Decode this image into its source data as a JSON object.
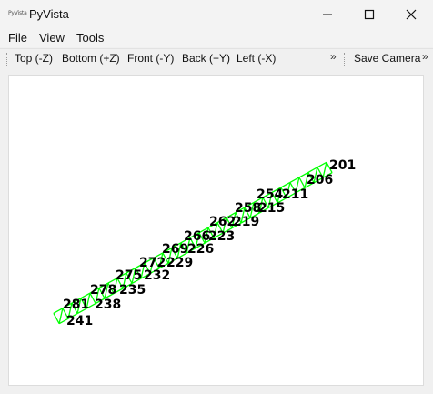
{
  "window": {
    "app_icon_text": "PyVista",
    "title": "PyVista"
  },
  "menu": {
    "items": [
      "File",
      "View",
      "Tools"
    ]
  },
  "toolbar": {
    "buttons": [
      "Top (-Z)",
      "Bottom (+Z)",
      "Front (-Y)",
      "Back (+Y)",
      "Left (-X)"
    ],
    "overflow_1": "»",
    "save_camera": "Save Camera",
    "overflow_2": "»"
  },
  "viewport": {
    "mesh_color": "#00ff00",
    "background": "#ffffff",
    "labels": [
      "201",
      "206",
      "254",
      "211",
      "258",
      "215",
      "262",
      "219",
      "266",
      "223",
      "269",
      "226",
      "272",
      "229",
      "275",
      "232",
      "278",
      "235",
      "281",
      "238",
      "241"
    ]
  }
}
